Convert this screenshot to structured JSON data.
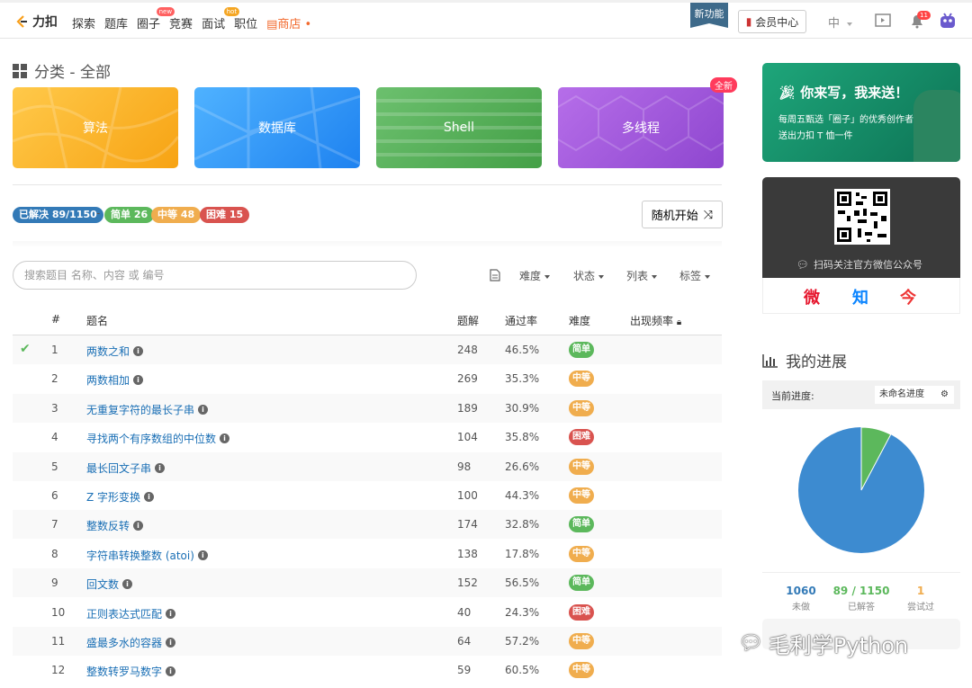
{
  "nav": {
    "logo": "力扣",
    "items": [
      {
        "label": "探索",
        "badge": ""
      },
      {
        "label": "题库",
        "badge": ""
      },
      {
        "label": "圈子",
        "badge": "new"
      },
      {
        "label": "竞赛",
        "badge": ""
      },
      {
        "label": "面试",
        "badge": "hot"
      },
      {
        "label": "职位",
        "badge": ""
      }
    ],
    "store": "商店",
    "new_feature": "新功能",
    "member": "会员中心",
    "lang": "中",
    "notifications": "11"
  },
  "category": {
    "title": "分类 - 全部",
    "cards": [
      "算法",
      "数据库",
      "Shell",
      "多线程"
    ],
    "new_badge": "全新"
  },
  "stats": {
    "solved": "已解决 89/1150",
    "easy": "简单 26",
    "medium": "中等 48",
    "hard": "困难 15",
    "random": "随机开始"
  },
  "search": {
    "placeholder": "搜索题目 名称、内容 或 编号"
  },
  "filters": [
    "难度",
    "状态",
    "列表",
    "标签"
  ],
  "table": {
    "headers": {
      "num": "#",
      "title": "题名",
      "solutions": "题解",
      "rate": "通过率",
      "difficulty": "难度",
      "frequency": "出现频率"
    },
    "rows": [
      {
        "num": "1",
        "title": "两数之和",
        "solutions": "248",
        "rate": "46.5%",
        "difficulty": "简单",
        "level": "easy",
        "solved": true
      },
      {
        "num": "2",
        "title": "两数相加",
        "solutions": "269",
        "rate": "35.3%",
        "difficulty": "中等",
        "level": "medium",
        "solved": false
      },
      {
        "num": "3",
        "title": "无重复字符的最长子串",
        "solutions": "189",
        "rate": "30.9%",
        "difficulty": "中等",
        "level": "medium",
        "solved": false
      },
      {
        "num": "4",
        "title": "寻找两个有序数组的中位数",
        "solutions": "104",
        "rate": "35.8%",
        "difficulty": "困难",
        "level": "hard",
        "solved": false
      },
      {
        "num": "5",
        "title": "最长回文子串",
        "solutions": "98",
        "rate": "26.6%",
        "difficulty": "中等",
        "level": "medium",
        "solved": false
      },
      {
        "num": "6",
        "title": "Z 字形变换",
        "solutions": "100",
        "rate": "44.3%",
        "difficulty": "中等",
        "level": "medium",
        "solved": false
      },
      {
        "num": "7",
        "title": "整数反转",
        "solutions": "174",
        "rate": "32.8%",
        "difficulty": "简单",
        "level": "easy",
        "solved": false
      },
      {
        "num": "8",
        "title": "字符串转换整数 (atoi)",
        "solutions": "138",
        "rate": "17.8%",
        "difficulty": "中等",
        "level": "medium",
        "solved": false
      },
      {
        "num": "9",
        "title": "回文数",
        "solutions": "152",
        "rate": "56.5%",
        "difficulty": "简单",
        "level": "easy",
        "solved": false
      },
      {
        "num": "10",
        "title": "正则表达式匹配",
        "solutions": "40",
        "rate": "24.3%",
        "difficulty": "困难",
        "level": "hard",
        "solved": false
      },
      {
        "num": "11",
        "title": "盛最多水的容器",
        "solutions": "64",
        "rate": "57.2%",
        "difficulty": "中等",
        "level": "medium",
        "solved": false
      },
      {
        "num": "12",
        "title": "整数转罗马数字",
        "solutions": "59",
        "rate": "60.5%",
        "difficulty": "中等",
        "level": "medium",
        "solved": false
      }
    ]
  },
  "promo": {
    "heading": "你来写，我来送！",
    "line1": "每周五甄选「圈子」的优秀创作者",
    "line2": "送出力扣 T 恤一件"
  },
  "qr": {
    "label": "扫码关注官方微信公众号"
  },
  "social": {
    "weibo": "微",
    "zhihu": "知",
    "other": "今"
  },
  "progress": {
    "title": "我的进展",
    "current_label": "当前进度:",
    "session": "未命名进度",
    "todo_value": "1060",
    "todo_label": "未做",
    "solved_value": "89 / 1150",
    "solved_label": "已解答",
    "attempted_value": "1",
    "attempted_label": "尝试过",
    "solved_fraction": 0.0774
  },
  "watermark": "毛利学Python",
  "colors": {
    "accent": "#1a6fb5",
    "easy": "#5cb85c",
    "medium": "#f0ad4e",
    "hard": "#d9534f",
    "pie_todo": "#3d8bd0",
    "pie_solved": "#5cb85c"
  }
}
